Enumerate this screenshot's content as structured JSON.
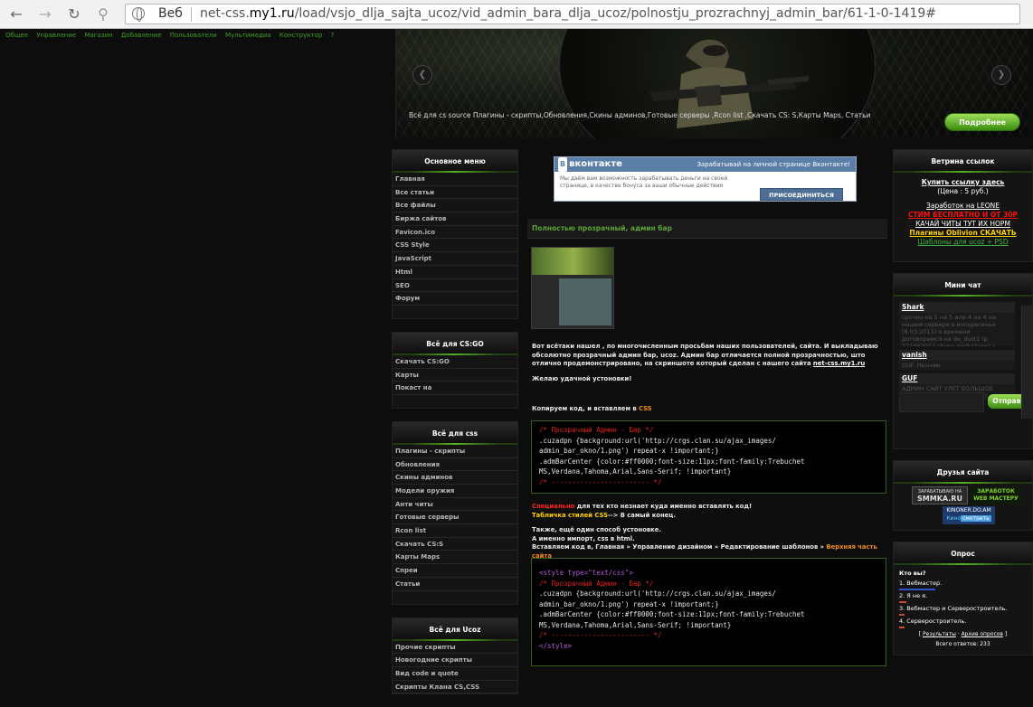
{
  "browser": {
    "protocol_label": "Веб",
    "url_prefix": "net-css.",
    "url_domain": "my1.ru",
    "url_path": "/load/vsjo_dlja_sajta_ucoz/vid_admin_bara_dlja_ucoz/polnostju_prozrachnyj_admin_bar/61-1-0-1419#"
  },
  "adminbar": [
    "Общее",
    "Управление",
    "Магазин",
    "Добавление",
    "Пользователи",
    "Мультимедиа",
    "Конструктор",
    "?"
  ],
  "header": {
    "caption": "Всё для cs source Плагины - скрипты,Обновления,Скины админов,Готовые серверы ,Rcon list ,Скачать CS: S,Карты Maps, Статьи",
    "more_button": "Подробнее"
  },
  "left": {
    "main_menu": {
      "title": "Основное меню",
      "items": [
        "Главная",
        "Все статьи",
        "Все файлы",
        "Биржа сайтов",
        "Favicon.ico",
        "CSS Style",
        "JavaScript",
        "Html",
        "SEO",
        "Форум"
      ]
    },
    "csgo": {
      "title": "Всё для CS:GO",
      "items": [
        "Скачать CS:GO",
        "Карты",
        "Покаст на"
      ]
    },
    "css": {
      "title": "Всё для css",
      "items": [
        "Плагины - скрипты",
        "Обновления",
        "Скины админов",
        "Модели оружия",
        "Анти читы",
        "Готовые серверы",
        "Rcon list",
        "Скачать CS:S",
        "Карты Maps",
        "Спреи",
        "Статьи"
      ]
    },
    "ucoz": {
      "title": "Всё для Ucoz",
      "items": [
        "Прочие скрипты",
        "Новогодние скрипты",
        "Вид code и quote",
        "Скрипты Клана CS,CSS"
      ]
    }
  },
  "vk_ad": {
    "logo": "вконтакте",
    "logo_prefix": "В",
    "slogan": "Зарабатывай на личной странице Вконтакте!",
    "body": "Мы даём вам возможность зарабатывать деньги на своей странице, в качестве бонуса за ваши обычные действия",
    "button": "ПРИСОЕДИНИТЬСЯ"
  },
  "article": {
    "title": "Полностью прозрачный, админ бар",
    "p1": "Вот всётаки нашел , по многочисленным просьбам наших пользователей, сайта. И выкладываю обсолютно прозрачный админ бар, ucoz. Админ бар отличается полной прозрачностью, што отлично продемонстрировано, на скриншоте который сделан с нашего сайта",
    "p1_link": "net-css.my1.ru",
    "p2": "Желаю удачной устоновки!",
    "p3_prefix": "Копируем код, и вставляем в",
    "p3_link": "CSS",
    "code1": [
      "/* Прозрачный Админ - Бар */",
      ".cuzadpn {background:url('http://crgs.clan.su/ajax_images/",
      "admin_bar_okno/1.png') repeat-x !important;}",
      ".admBarCenter {color:#ff0000;font-size:11px;font-family:Trebuchet",
      "MS,Verdana,Tahoma,Arial,Sans-Serif; !important}",
      "/* ------------------------ */"
    ],
    "special_red": "Специально",
    "special_rest": " для тех кто незнает куда именно вставлять код!",
    "table_yellow": "Табличка стилей CSS",
    "table_rest": "--> В самый конец.",
    "p5_l1": "Также, ещё один способ устоновке.",
    "p5_l2": "А именно импорт, css в html.",
    "p5_l3_prefix": "Вставляем код в, Главная » Управление дизайном » Редактирование шаблонов »",
    "p5_l3_orange": "Верхняя часть сайта",
    "code2": [
      "<style type=\"text/css\">",
      "/* Прозрачный Админ - Бар */",
      ".cuzadpn {background:url('http://crgs.clan.su/ajax_images/",
      "admin_bar_okno/1.png') repeat-x !important;}",
      ".admBarCenter {color:#ff0000;font-size:11px;font-family:Trebuchet",
      "MS,Verdana,Tahoma,Arial,Sans-Serif; !important}",
      "/* ------------------------ */",
      "</style>"
    ]
  },
  "right": {
    "links_box": {
      "title": "Ветрина ссылок",
      "buy_link": "Купить ссылку здесь",
      "price": "(Цена : 5 руб.)",
      "links": [
        {
          "text": "Заработок на LEONE",
          "color": "#ffffff"
        },
        {
          "text": "СТИМ БЕСПЛАТНО И ОТ 30Р",
          "color": "#ff1010"
        },
        {
          "text": "КАЧАЙ ЧИТЫ ТУТ ИХ НОРМ",
          "color": "#ffffff"
        },
        {
          "text": "Плагины Oblivion СКАЧАТЬ",
          "color": "#ffd000"
        },
        {
          "text": "Шаблоны для ucoz + PSD",
          "color": "#3fb43f"
        }
      ]
    },
    "chat": {
      "title": "Мини чат",
      "messages": [
        {
          "user": "Shark",
          "text": "срочно кв 5 на 5 или 4 на 4 на нашем сервере в воскресенье (8.03.2013) о времени договоримся на de_dust2 Ip 171063012 skype gosha1pro1 ( лучше в вк) клан: KGS gtoo6"
        },
        {
          "user": "vanish",
          "text": "GUF. Незнаю."
        },
        {
          "user": "GUF",
          "text": "АДМИН САЙТ УЛЕТ БОЛЬШОЕ СПАСИБО ОТ КЛАНА CSG™!"
        }
      ],
      "more": "• • • •",
      "send_button": "Отправить"
    },
    "friends": {
      "title": "Друзья сайта",
      "banner1_top": "ЗАРАБАТЫВАЮ НА",
      "banner1_main": "SMMKA.RU",
      "banner2_text": "ЗАРАБОТОК WEB МАСТЕРУ",
      "banner3_top": "KINONER.DO.AM",
      "banner3_kino": "Кино",
      "banner3_watch": "смотреть"
    },
    "poll": {
      "title": "Опрос",
      "question": "Кто вы?",
      "options": [
        {
          "text": "1. Вебмастер.",
          "color": "#2c52c8"
        },
        {
          "text": "2. Я не я.",
          "color": "#d0482a"
        },
        {
          "text": "3. Вебмастер и Сервероcтроитель.",
          "color": "#d0482a"
        },
        {
          "text": "4. Сервероcтроитель.",
          "color": "#d0482a"
        }
      ],
      "results_link": "Результаты",
      "archive_link": "Архив опросов",
      "total": "Всего ответов: 233"
    }
  }
}
